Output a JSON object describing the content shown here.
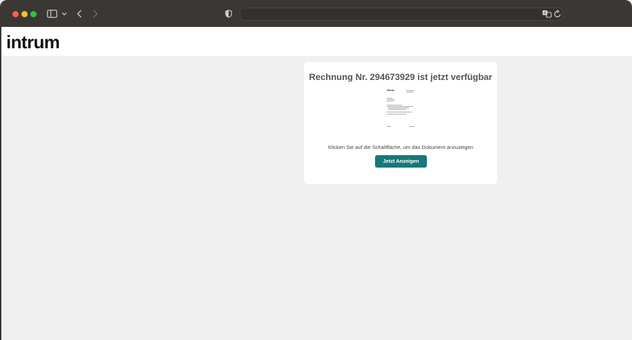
{
  "browser": {
    "address_value": "",
    "icons": {
      "sidebar": "sidebar-icon",
      "sidebar_menu": "chevron-down-icon",
      "back": "chevron-left-icon",
      "forward": "chevron-right-icon",
      "privacy": "shield-icon",
      "translate": "translate-icon",
      "reload": "reload-icon"
    }
  },
  "site": {
    "logo_text": "intrum"
  },
  "card": {
    "title": "Rechnung Nr. 294673929 ist jetzt verfügbar",
    "instruction": "Klicken Sie auf die Schaltfläche, um das Dokument anzuzeigen",
    "button_label": "Jetzt Anzeigen",
    "thumbnail_logo": "intrum"
  },
  "colors": {
    "toolbar": "#3b3735",
    "page_background": "#f0f0f0",
    "button": "#177779",
    "traffic_red": "#fe5f57",
    "traffic_yellow": "#febc2e",
    "traffic_green": "#28c840"
  }
}
